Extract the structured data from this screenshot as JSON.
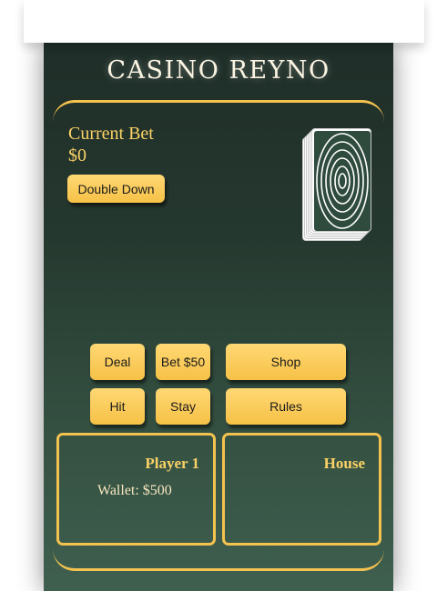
{
  "title": "CASINO REYNO",
  "bet": {
    "label": "Current Bet",
    "value": "$0"
  },
  "buttons": {
    "double_down": "Double Down",
    "deal": "Deal",
    "bet": "Bet $50",
    "shop": "Shop",
    "hit": "Hit",
    "stay": "Stay",
    "rules": "Rules"
  },
  "player": {
    "name": "Player 1",
    "wallet": "Wallet: $500"
  },
  "house": {
    "name": "House"
  },
  "colors": {
    "accent": "#f4c24f",
    "felt_top": "#1f2e28",
    "felt_bottom": "#3f5f4f",
    "card_back": "#2f4b3e"
  },
  "icons": {
    "deck": "card-deck-icon"
  }
}
